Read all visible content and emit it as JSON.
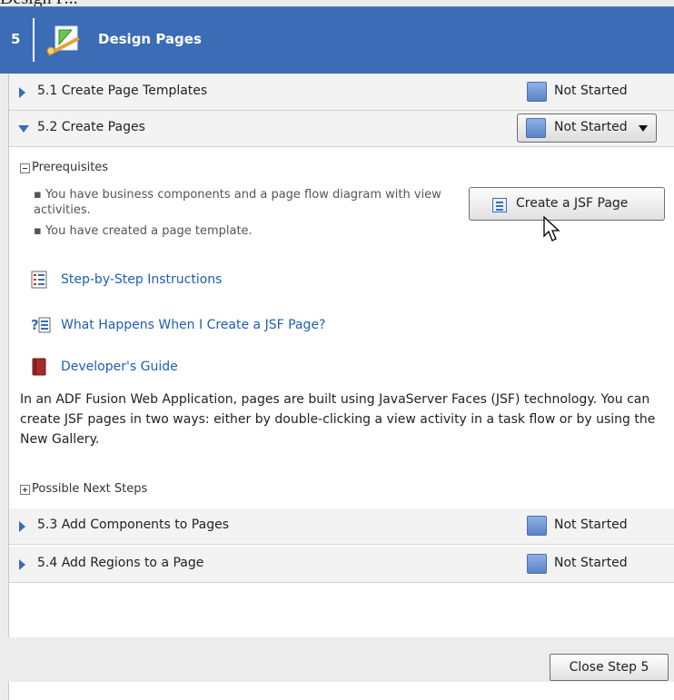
{
  "header": {
    "step_number": "5",
    "title": "Design Pages",
    "top_fragment": "Design P..."
  },
  "substeps": [
    {
      "label": "5.1 Create Page Templates",
      "status": "Not Started",
      "expanded": false
    },
    {
      "label": "5.2 Create Pages",
      "status": "Not Started",
      "expanded": true
    },
    {
      "label": "5.3 Add Components to Pages",
      "status": "Not Started",
      "expanded": false
    },
    {
      "label": "5.4 Add Regions to a Page",
      "status": "Not Started",
      "expanded": false
    }
  ],
  "prerequisites": {
    "label": "Prerequisites",
    "items": [
      "You have business components and a page flow diagram with view activities.",
      "You have created a page template."
    ]
  },
  "create_button": {
    "label": "Create a JSF Page"
  },
  "links": [
    {
      "label": "Step-by-Step Instructions",
      "icon": "checklist-icon"
    },
    {
      "label": "What Happens When I Create a JSF Page?",
      "icon": "help-topic-icon"
    },
    {
      "label": "Developer's Guide",
      "icon": "book-icon"
    }
  ],
  "description": "In an ADF Fusion Web Application, pages are built using JavaServer Faces (JSF) technology. You can create JSF pages in two ways: either by double-clicking a view activity in a task flow or by using the New Gallery.",
  "possible_next_steps": {
    "label": "Possible Next Steps"
  },
  "footer": {
    "close_label": "Close Step 5"
  },
  "colors": {
    "accent": "#3b6cb5",
    "link": "#1e5fae",
    "status_blue": "#5a83c8"
  }
}
